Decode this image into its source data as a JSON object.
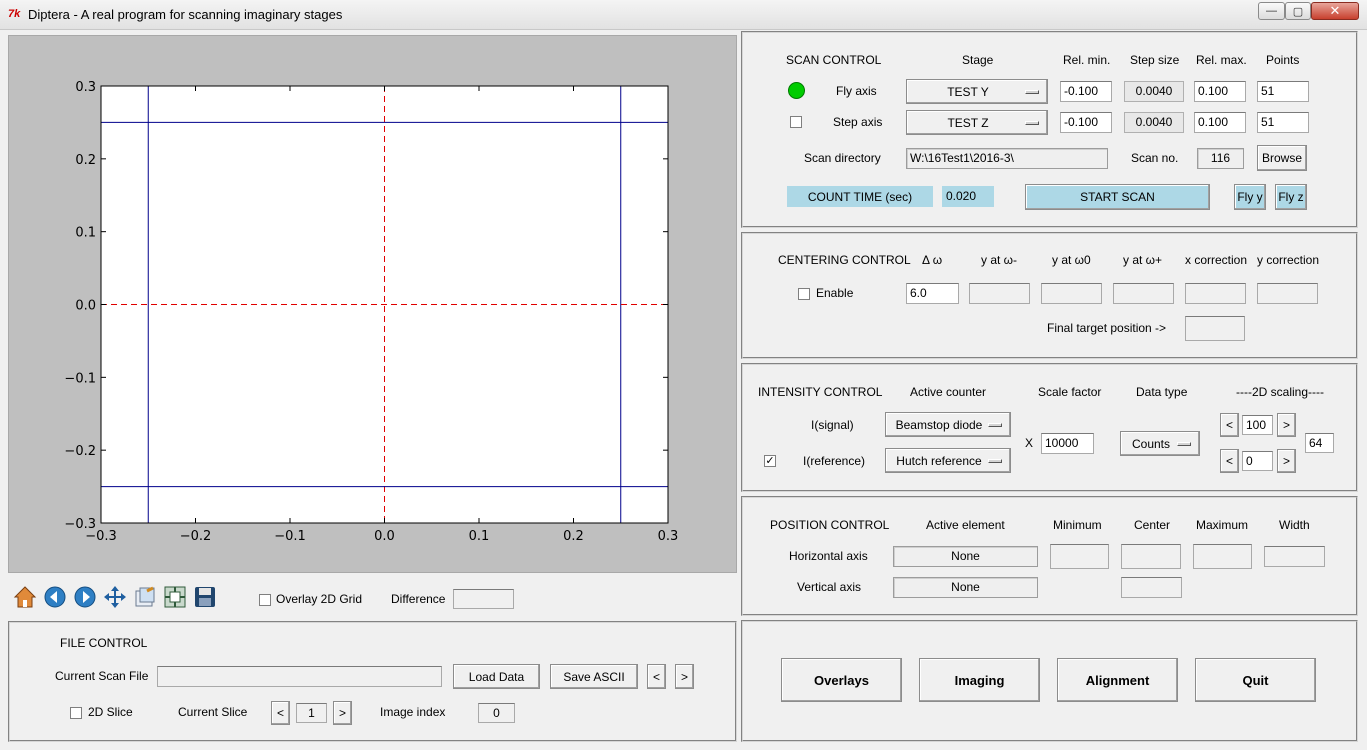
{
  "window": {
    "title": "Diptera - A real program for scanning imaginary stages",
    "icon": "tk-feather-icon",
    "controls": {
      "minimize": "—",
      "maximize": "▢",
      "close": "✕"
    }
  },
  "plot": {
    "chart_data": {
      "type": "line",
      "xlim": [
        -0.3,
        0.3
      ],
      "ylim": [
        -0.3,
        0.3
      ],
      "x_ticks": [
        "−0.3",
        "−0.2",
        "−0.1",
        "0.0",
        "0.1",
        "0.2",
        "0.3"
      ],
      "y_ticks": [
        "0.3",
        "0.2",
        "0.1",
        "0.0",
        "−0.1",
        "−0.2",
        "−0.3"
      ],
      "vertical_lines": [
        {
          "x": -0.25,
          "color": "#00008b",
          "style": "solid"
        },
        {
          "x": 0.25,
          "color": "#00008b",
          "style": "solid"
        },
        {
          "x": 0.0,
          "color": "#e00000",
          "style": "dashed"
        }
      ],
      "horizontal_lines": [
        {
          "y": 0.25,
          "color": "#00008b",
          "style": "solid"
        },
        {
          "y": -0.25,
          "color": "#00008b",
          "style": "solid"
        },
        {
          "y": 0.0,
          "color": "#e00000",
          "style": "dashed"
        }
      ]
    }
  },
  "toolbar": {
    "tools": [
      "home-icon",
      "back-icon",
      "forward-icon",
      "pan-icon",
      "configure-icon",
      "zoom-icon",
      "save-icon"
    ],
    "overlay_label": "Overlay 2D Grid",
    "overlay_checked": false,
    "difference_label": "Difference",
    "difference_value": ""
  },
  "file_control": {
    "title": "FILE CONTROL",
    "current_scan_file_label": "Current Scan File",
    "current_scan_file_value": "",
    "load_data": "Load Data",
    "save_ascii": "Save ASCII",
    "prev": "<",
    "next": ">",
    "slice_2d_label": "2D Slice",
    "current_slice_label": "Current Slice",
    "slice_prev": "<",
    "slice_value": "1",
    "slice_next": ">",
    "image_index_label": "Image index",
    "image_index_value": "0"
  },
  "scan_control": {
    "title": "SCAN CONTROL",
    "headers": {
      "stage": "Stage",
      "rel_min": "Rel. min.",
      "step": "Step size",
      "rel_max": "Rel. max.",
      "points": "Points"
    },
    "fly": {
      "label": "Fly axis",
      "stage": "TEST Y",
      "rel_min": "-0.100",
      "step": "0.0040",
      "rel_max": "0.100",
      "points": "51",
      "indicator_color": "#00cc00"
    },
    "step_axis": {
      "label": "Step axis",
      "stage": "TEST Z",
      "rel_min": "-0.100",
      "step": "0.0040",
      "rel_max": "0.100",
      "points": "51"
    },
    "dir_label": "Scan directory",
    "dir_value": "W:\\16Test1\\2016-3\\",
    "scan_no_label": "Scan no.",
    "scan_no_value": "116",
    "browse": "Browse",
    "count_time_label": "COUNT TIME (sec)",
    "count_time_value": "0.020",
    "start_scan": "START SCAN",
    "fly_y": "Fly y",
    "fly_z": "Fly z"
  },
  "centering": {
    "title": "CENTERING CONTROL",
    "headers": {
      "delta": "Δ ω",
      "y_minus": "y at ω-",
      "y0": "y at ω0",
      "y_plus": "y at ω+",
      "xcorr": "x correction",
      "ycorr": "y correction"
    },
    "enable_label": "Enable",
    "delta_value": "6.0",
    "final_label": "Final target position ->"
  },
  "intensity": {
    "title": "INTENSITY CONTROL",
    "headers": {
      "counter": "Active counter",
      "scale": "Scale factor",
      "dtype": "Data type",
      "scaling": "----2D scaling----"
    },
    "signal_label": "I(signal)",
    "signal_value": "Beamstop diode",
    "ref_label": "I(reference)",
    "ref_value": "Hutch reference",
    "ref_checked": true,
    "x_label": "X",
    "scale_value": "10000",
    "dtype_value": "Counts",
    "lt": "<",
    "gt": ">",
    "scale_hi": "100",
    "scale_lo": "0",
    "scale_extra": "64"
  },
  "position": {
    "title": "POSITION CONTROL",
    "headers": {
      "element": "Active element",
      "min": "Minimum",
      "center": "Center",
      "max": "Maximum",
      "width": "Width"
    },
    "horiz_label": "Horizontal axis",
    "horiz_value": "None",
    "vert_label": "Vertical axis",
    "vert_value": "None"
  },
  "nav": {
    "overlays": "Overlays",
    "imaging": "Imaging",
    "alignment": "Alignment",
    "quit": "Quit"
  }
}
